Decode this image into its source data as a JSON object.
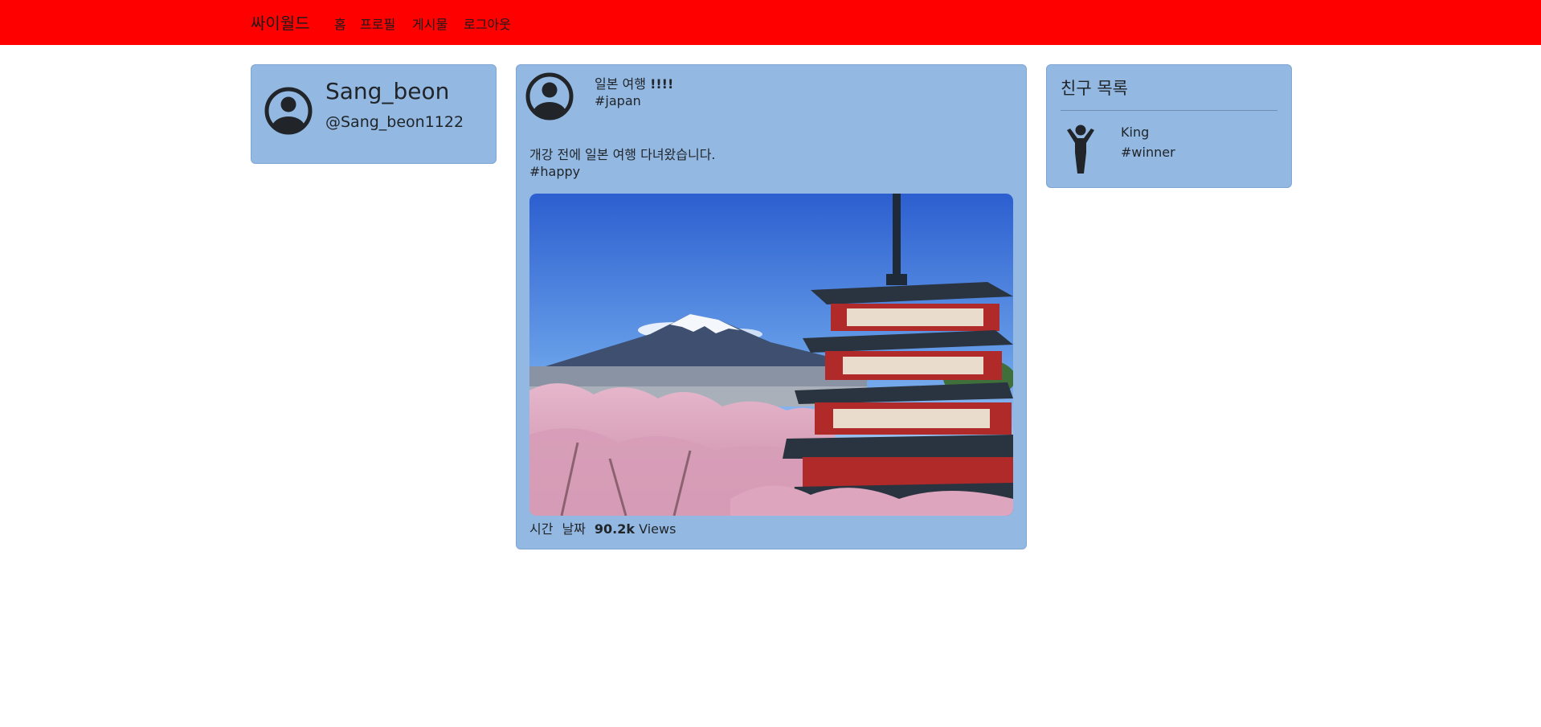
{
  "navbar": {
    "brand": "싸이월드",
    "links": [
      "홈",
      "프로필",
      "게시물",
      "로그아웃"
    ],
    "background": "#ff0000"
  },
  "profile": {
    "avatar_icon": "person-circle-icon",
    "name": "Sang_beon",
    "handle": "@Sang_beon1122"
  },
  "post": {
    "avatar_icon": "person-circle-icon",
    "title_text": "일본 여행 ",
    "title_emphasis": "!!!!",
    "title_tag": "#japan",
    "body": "개강 전에 일본 여행 다녀왔습니다.",
    "body_tag": "#happy",
    "image_icon": "mount-fuji-pagoda-photo",
    "footer": {
      "time": "시간",
      "date": "날짜",
      "views_count": "90.2k",
      "views_label": "Views"
    }
  },
  "friends": {
    "title": "친구 목록",
    "items": [
      {
        "icon": "person-arms-up-icon",
        "name": "King",
        "tag": "#winner"
      }
    ]
  },
  "colors": {
    "card_background": "#93b9e3",
    "navbar": "#ff0000"
  }
}
